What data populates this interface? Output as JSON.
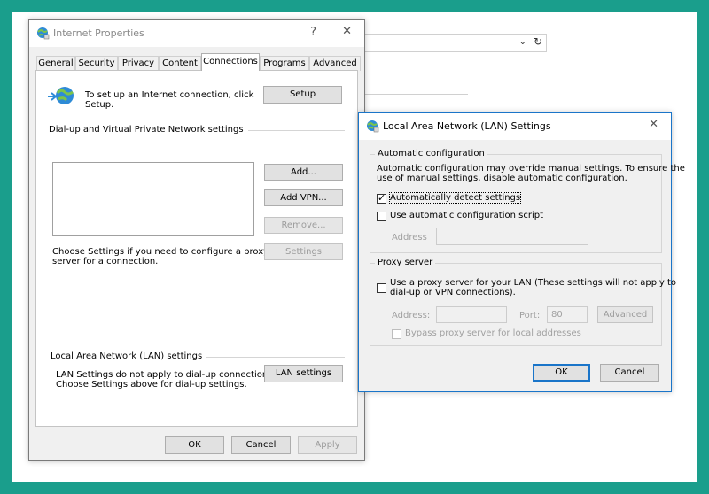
{
  "background": {
    "chevron": "⌄",
    "refresh": "↻"
  },
  "internet_properties": {
    "title": "Internet Properties",
    "help_glyph": "?",
    "close_glyph": "✕",
    "tabs": [
      {
        "label": "General"
      },
      {
        "label": "Security"
      },
      {
        "label": "Privacy"
      },
      {
        "label": "Content"
      },
      {
        "label": "Connections",
        "active": true
      },
      {
        "label": "Programs"
      },
      {
        "label": "Advanced"
      }
    ],
    "setup_text_line1": "To set up an Internet connection, click",
    "setup_text_line2": "Setup.",
    "setup_button": "Setup",
    "dialup_section": "Dial-up and Virtual Private Network settings",
    "add_button": "Add...",
    "add_vpn_button": "Add VPN...",
    "remove_button": "Remove...",
    "settings_button": "Settings",
    "choose_text_line1": "Choose Settings if you need to configure a proxy",
    "choose_text_line2": "server for a connection.",
    "lan_section": "Local Area Network (LAN) settings",
    "lan_text_line1": "LAN Settings do not apply to dial-up connections.",
    "lan_text_line2": "Choose Settings above for dial-up settings.",
    "lan_button": "LAN settings",
    "ok": "OK",
    "cancel": "Cancel",
    "apply": "Apply"
  },
  "lan_dialog": {
    "title": "Local Area Network (LAN) Settings",
    "close_glyph": "✕",
    "auto_group": "Automatic configuration",
    "auto_desc_line1": "Automatic configuration may override manual settings.  To ensure the",
    "auto_desc_line2": "use of manual settings, disable automatic configuration.",
    "auto_detect_label": "Automatically detect settings",
    "auto_detect_checked": true,
    "auto_script_label": "Use automatic configuration script",
    "auto_script_checked": false,
    "script_address_label": "Address",
    "proxy_group": "Proxy server",
    "use_proxy_line1": "Use a proxy server for your LAN (These settings will not apply to",
    "use_proxy_line2": "dial-up or VPN connections).",
    "use_proxy_checked": false,
    "address_label": "Address:",
    "port_label": "Port:",
    "port_value": "80",
    "advanced_button": "Advanced",
    "bypass_label": "Bypass proxy server for local addresses",
    "bypass_checked": false,
    "ok": "OK",
    "cancel": "Cancel",
    "check_glyph": "✓"
  },
  "colors": {
    "backdrop": "#1a9e8c",
    "accent": "#1a75c9"
  }
}
